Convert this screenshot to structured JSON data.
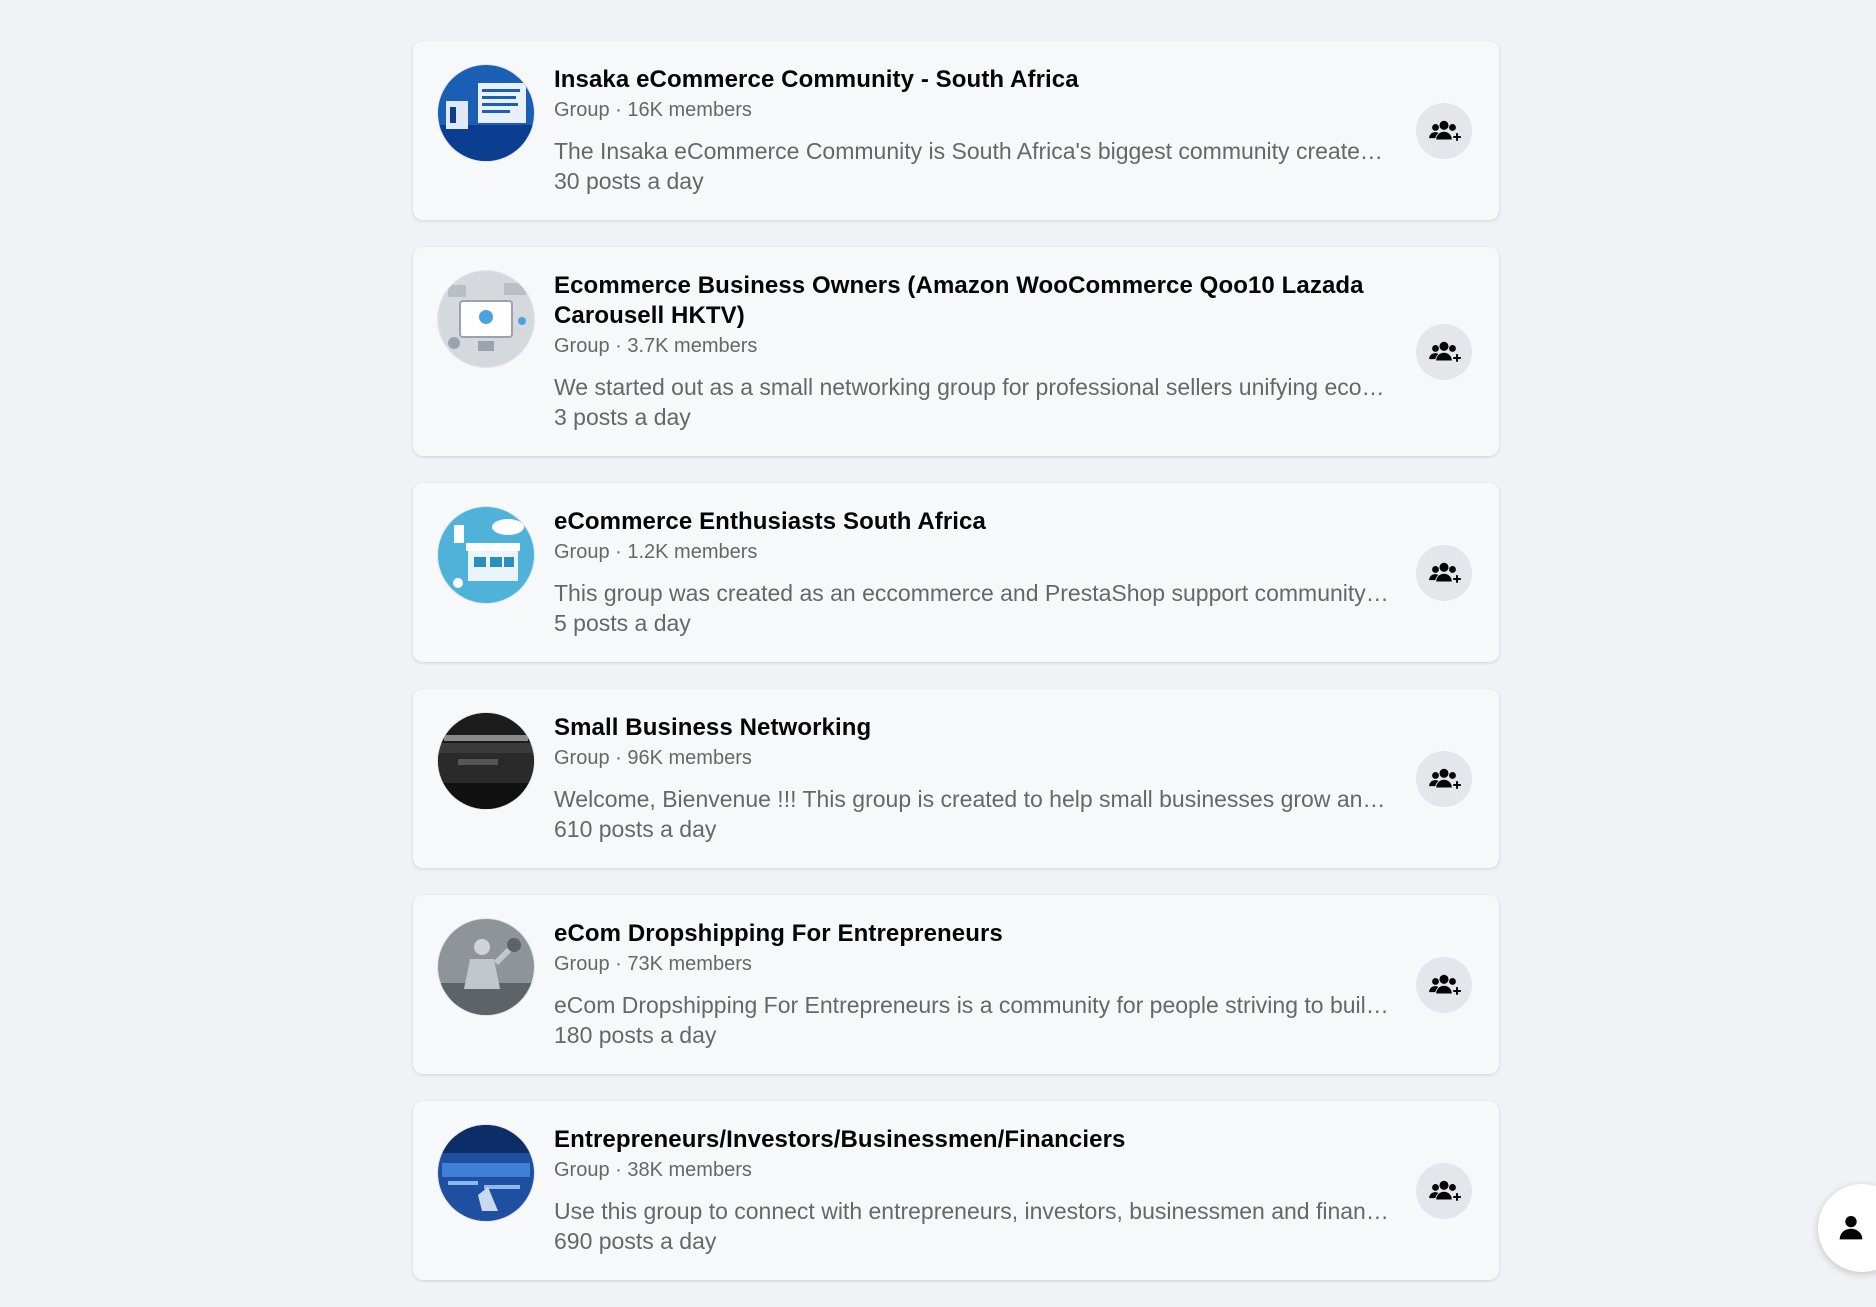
{
  "groups": [
    {
      "title": "Insaka eCommerce Community - South Africa",
      "meta": "Group · 16K members",
      "description": "The Insaka eCommerce Community is South Africa's biggest community created to connect online sellers",
      "activity": "30 posts a day",
      "avatar_colors": [
        "#1a5fb4",
        "#0b3d91"
      ],
      "join_icon": "join-group-icon"
    },
    {
      "title": "Ecommerce Business Owners (Amazon WooCommerce Qoo10 Lazada Carousell HKTV)",
      "meta": "Group · 3.7K members",
      "description": "We started out as a small networking group for professional sellers unifying ecommerce knowledge",
      "activity": "3 posts a day",
      "avatar_colors": [
        "#d5d8dc",
        "#9aa3ad"
      ],
      "join_icon": "join-group-icon"
    },
    {
      "title": "eCommerce Enthusiasts South Africa",
      "meta": "Group · 1.2K members",
      "description": "This group was created as an eccommerce and PrestaShop support community for South Africa",
      "activity": "5 posts a day",
      "avatar_colors": [
        "#4fb3d9",
        "#2a8fbd"
      ],
      "join_icon": "join-group-icon"
    },
    {
      "title": "Small Business Networking",
      "meta": "Group · 96K members",
      "description": "Welcome, Bienvenue !!! This group is created to help small businesses grow and network",
      "activity": "610 posts a day",
      "avatar_colors": [
        "#3a3a3a",
        "#111111"
      ],
      "join_icon": "join-group-icon"
    },
    {
      "title": "eCom Dropshipping For Entrepreneurs",
      "meta": "Group · 73K members",
      "description": "eCom Dropshipping For Entrepreneurs is a community for people striving to build online stores",
      "activity": "180 posts a day",
      "avatar_colors": [
        "#8e9499",
        "#5d6469"
      ],
      "join_icon": "join-group-icon"
    },
    {
      "title": "Entrepreneurs/Investors/Businessmen/Financiers",
      "meta": "Group · 38K members",
      "description": "Use this group to connect with entrepreneurs, investors, businessmen and financiers worldwide",
      "activity": "690 posts a day",
      "avatar_colors": [
        "#1e4fa0",
        "#0c2d66"
      ],
      "join_icon": "join-group-icon"
    }
  ],
  "corner_button": {
    "icon": "person-icon"
  }
}
